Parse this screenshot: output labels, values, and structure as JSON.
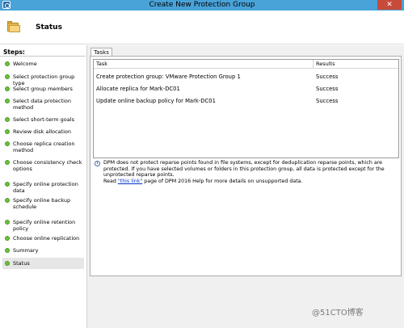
{
  "window": {
    "title": "Create New Protection Group",
    "close_glyph": "✕"
  },
  "header": {
    "page_title": "Status",
    "icon": "folder-icon"
  },
  "steps": {
    "heading": "Steps:",
    "items": [
      {
        "label": "Welcome"
      },
      {
        "label": "Select protection group type"
      },
      {
        "label": "Select group members"
      },
      {
        "label": "Select data protection method"
      },
      {
        "label": "Select short-term goals"
      },
      {
        "label": "Review disk allocation"
      },
      {
        "label": "Choose replica creation method"
      },
      {
        "label": "Choose consistency check options"
      },
      {
        "label": "Specify online protection data"
      },
      {
        "label": "Specify online backup schedule"
      },
      {
        "label": "Specify online retention policy"
      },
      {
        "label": "Choose online replication"
      },
      {
        "label": "Summary"
      },
      {
        "label": "Status"
      }
    ],
    "current": "Status",
    "status_color": "#6cbf3c"
  },
  "tasks": {
    "tab_label": "Tasks",
    "columns": {
      "task": "Task",
      "results": "Results"
    },
    "rows": [
      {
        "task": "Create protection group: VMware Protection Group 1",
        "result": "Success"
      },
      {
        "task": "Allocate replica for Mark-DC01",
        "result": "Success"
      },
      {
        "task": "Update online backup policy for Mark-DC01",
        "result": "Success"
      }
    ]
  },
  "info": {
    "icon": "info-icon",
    "text_1": "DPM does not protect reparse points found in file systems, except for deduplication reparse points, which are protected. If you have selected volumes or folders in this protection group, all data is protected except for the unprotected reparse points.",
    "text_2_prefix": "Read ",
    "link_text": "\"this link\"",
    "text_2_suffix": " page of DPM 2016 Help for more details on unsupported data."
  },
  "watermark": "@51CTO博客",
  "colors": {
    "titlebar": "#49a3d8",
    "close": "#c74a3a",
    "link": "#0033cc"
  }
}
